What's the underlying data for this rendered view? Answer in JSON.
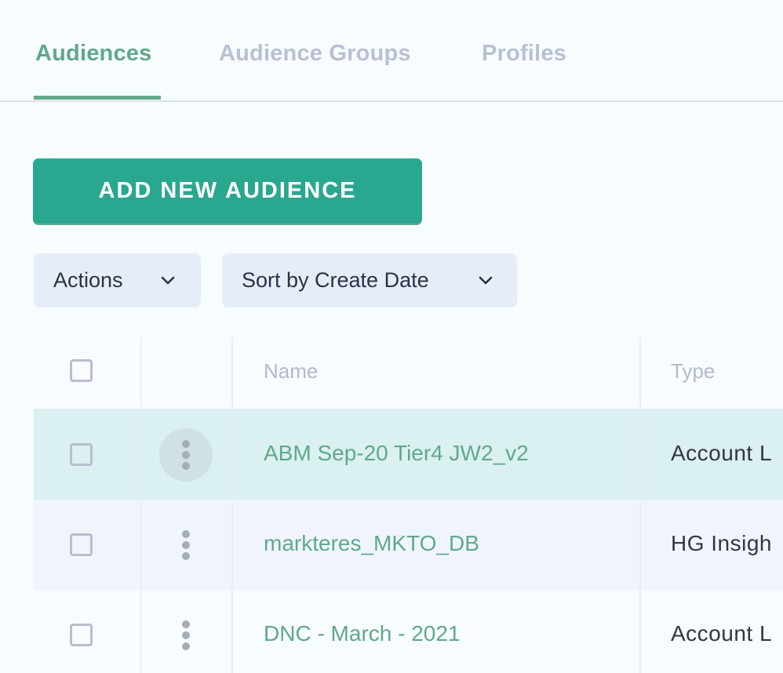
{
  "tabs": [
    {
      "label": "Audiences",
      "active": true
    },
    {
      "label": "Audience Groups",
      "active": false
    },
    {
      "label": "Profiles",
      "active": false
    }
  ],
  "toolbar": {
    "add_button_label": "ADD NEW AUDIENCE",
    "actions_label": "Actions",
    "sort_label": "Sort by Create Date"
  },
  "table": {
    "columns": [
      "",
      "",
      "Name",
      "Type"
    ],
    "rows": [
      {
        "name": "ABM Sep-20 Tier4 JW2_v2",
        "type": "Account L",
        "hovered": true
      },
      {
        "name": "markteres_MKTO_DB",
        "type": "HG Insigh",
        "hovered": false
      },
      {
        "name": "DNC - March - 2021",
        "type": "Account L",
        "hovered": false
      }
    ]
  },
  "colors": {
    "accent_green": "#5fa98a",
    "button_teal": "#2aa78f",
    "dropdown_bg": "#e6edf9",
    "hover_row_bg": "#dbf0f1",
    "alt_row_bg": "#f0f5fd",
    "inactive_tab": "#b9c0d4"
  }
}
